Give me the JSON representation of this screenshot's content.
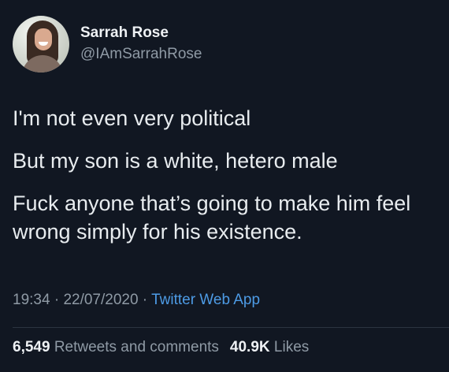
{
  "author": {
    "display_name": "Sarrah Rose",
    "handle": "@IAmSarrahRose",
    "avatar_icon": "profile-photo"
  },
  "tweet": {
    "lines": [
      "I'm not even very political",
      "But my son is a white, hetero male",
      "Fuck anyone that’s going to make him feel wrong simply for his existence."
    ]
  },
  "meta": {
    "time": "19:34",
    "separator": " · ",
    "date": "22/07/2020",
    "source": "Twitter Web App"
  },
  "stats": {
    "retweets_count": "6,549",
    "retweets_label": "Retweets and comments",
    "likes_count": "40.9K",
    "likes_label": "Likes"
  },
  "colors": {
    "background": "#111722",
    "text": "#e8ecef",
    "secondary": "#8f9aa5",
    "link": "#4d9be5"
  }
}
